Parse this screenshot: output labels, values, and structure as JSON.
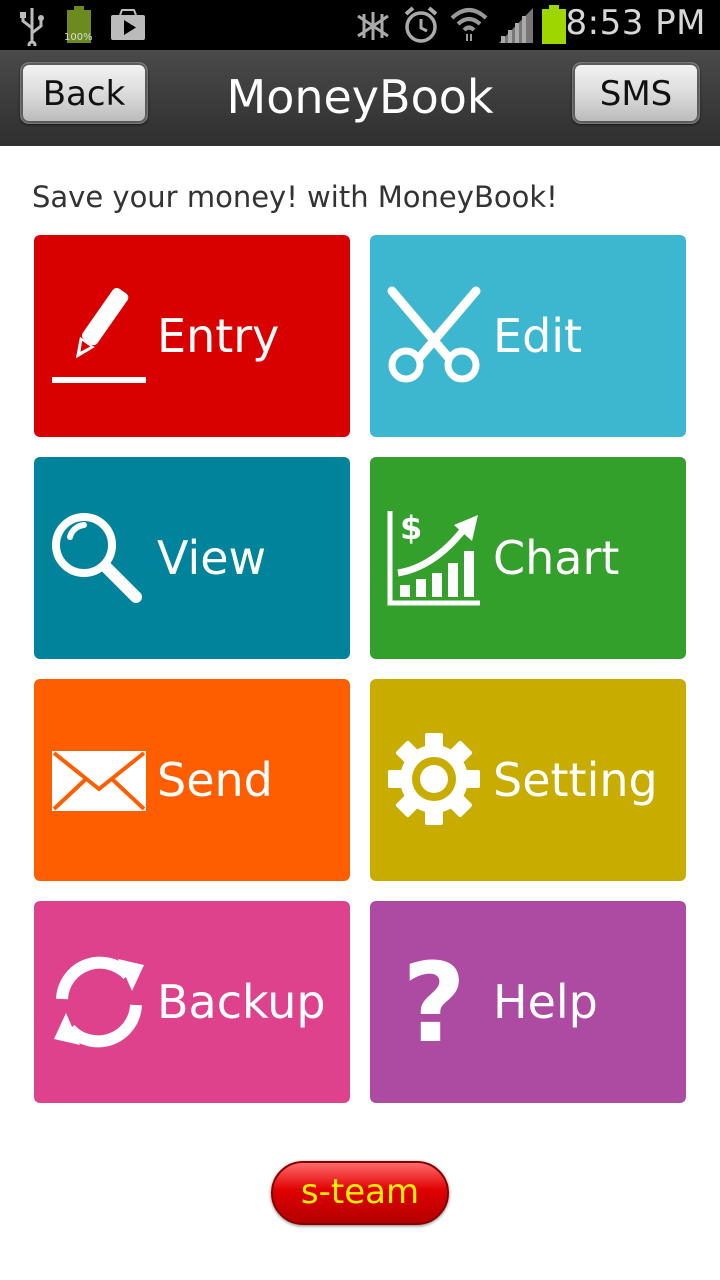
{
  "status_bar": {
    "time": "8:53 PM",
    "battery_percent": "100%",
    "icons": [
      "usb-icon",
      "battery-icon",
      "play-store-icon",
      "mute-icon",
      "alarm-icon",
      "wifi-icon",
      "signal-icon",
      "battery-level-icon"
    ]
  },
  "header": {
    "title": "MoneyBook",
    "back_label": "Back",
    "sms_label": "SMS"
  },
  "tagline": "Save your money! with MoneyBook!",
  "tiles": [
    {
      "label": "Entry",
      "icon": "pencil-icon",
      "color": "#d90000"
    },
    {
      "label": "Edit",
      "icon": "scissors-icon",
      "color": "#3db7d0"
    },
    {
      "label": "View",
      "icon": "magnifier-icon",
      "color": "#00839b"
    },
    {
      "label": "Chart",
      "icon": "chart-icon",
      "color": "#33a02b"
    },
    {
      "label": "Send",
      "icon": "envelope-icon",
      "color": "#ff5e00"
    },
    {
      "label": "Setting",
      "icon": "gear-icon",
      "color": "#c8ac00"
    },
    {
      "label": "Backup",
      "icon": "sync-icon",
      "color": "#de428d"
    },
    {
      "label": "Help",
      "icon": "question-icon",
      "color": "#ad4aa1"
    }
  ],
  "footer_button": "s-team"
}
